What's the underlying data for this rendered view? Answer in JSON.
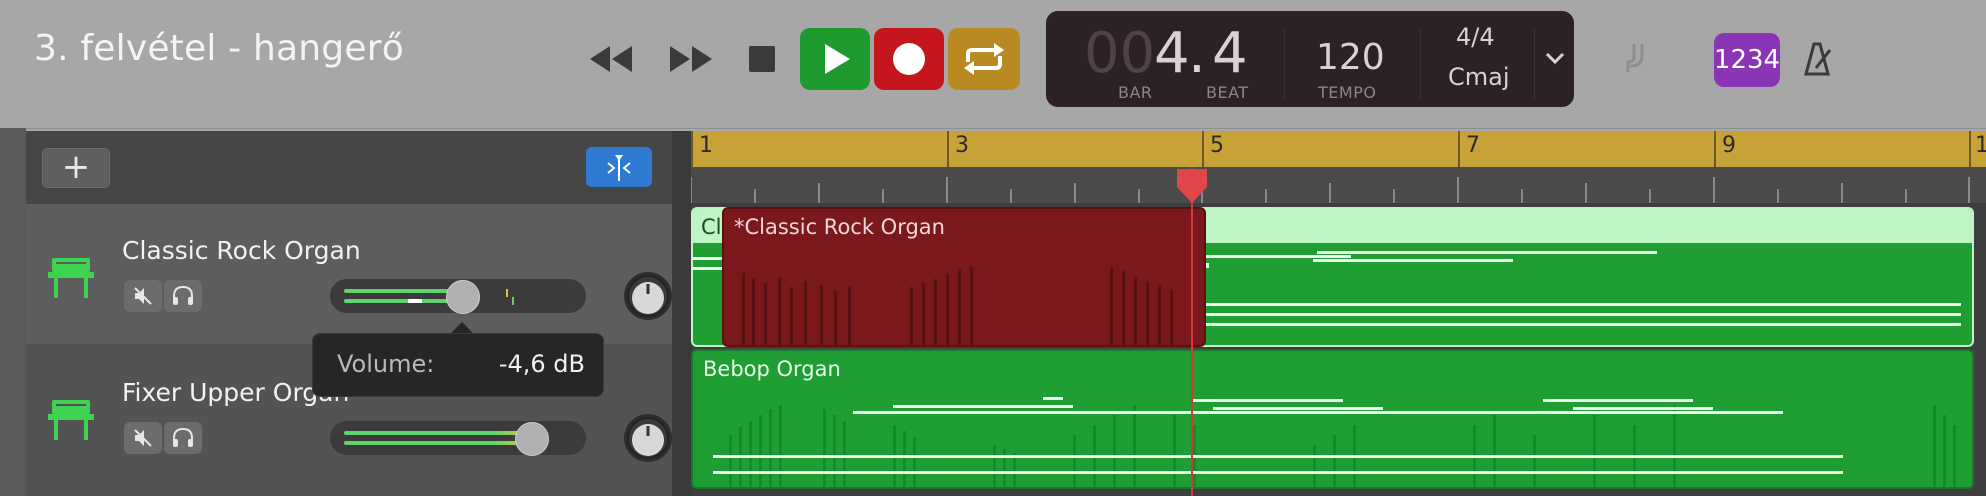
{
  "window": {
    "title": "3. felvétel - hangerő"
  },
  "transport": {
    "rewind_icon": "rewind-icon",
    "forward_icon": "fast-forward-icon",
    "stop_icon": "stop-icon",
    "play_icon": "play-icon",
    "record_icon": "record-icon",
    "cycle_icon": "cycle-icon",
    "colors": {
      "play": "#1f9a2e",
      "record": "#c4161c",
      "cycle": "#b98a21"
    }
  },
  "lcd": {
    "bar_dim": "00",
    "bar_value": "4",
    "dot": ".",
    "beat_value": "4",
    "bar_label": "BAR",
    "beat_label": "BEAT",
    "tempo_value": "120",
    "tempo_label": "TEMPO",
    "time_signature": "4/4",
    "key": "Cmaj"
  },
  "toolbar_right": {
    "count_in_label": "1234",
    "count_in_color": "#8a35b6"
  },
  "tracks_header": {
    "add_label": "+"
  },
  "tracks": [
    {
      "name": "Classic Rock Organ",
      "volume_fraction": 0.52
    },
    {
      "name": "Fixer Upper Organ",
      "volume_fraction": 0.87
    }
  ],
  "tooltip": {
    "label": "Volume:",
    "value": "-4,6 dB"
  },
  "ruler": {
    "marks": [
      "1",
      "3",
      "5",
      "7",
      "9",
      "1"
    ]
  },
  "regions": {
    "track1_region_a_label": "Cl",
    "track1_region_b_label": "*Classic Rock Organ",
    "track2_region_label": "Bebop Organ"
  }
}
